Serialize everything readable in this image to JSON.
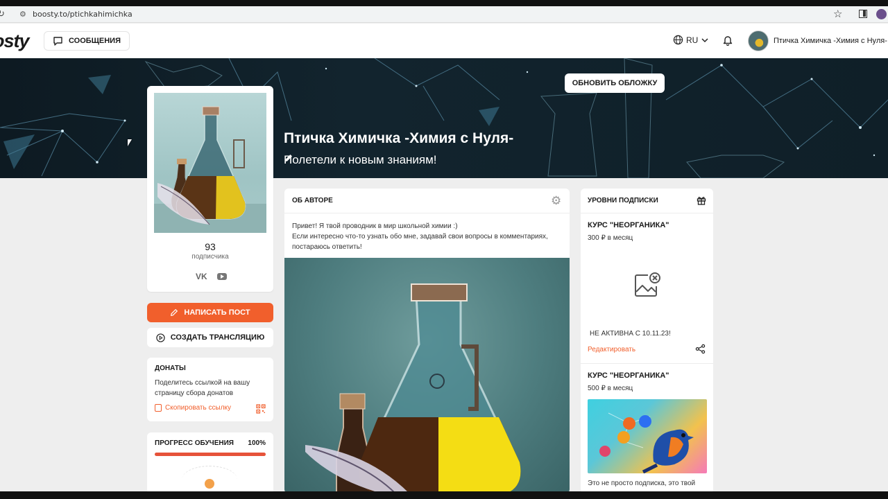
{
  "browser": {
    "url": "boosty.to/ptichkahimichka"
  },
  "header": {
    "logo": "osty",
    "messages_label": "СООБЩЕНИЯ",
    "lang_label": "RU",
    "user_name": "Птичка Химичка -Химия с Нуля-"
  },
  "cover": {
    "update_cover_label": "ОБНОВИТЬ ОБЛОЖКУ",
    "title": "Птичка Химичка -Химия с Нуля-",
    "subtitle": "Полетели к новым знаниям!"
  },
  "profile": {
    "subscribers_count": "93",
    "subscribers_label": "подписчика"
  },
  "actions": {
    "write_post_label": "НАПИСАТЬ ПОСТ",
    "create_stream_label": "СОЗДАТЬ ТРАНСЛЯЦИЮ"
  },
  "donations": {
    "title": "ДОНАТЫ",
    "text": "Поделитесь ссылкой на вашу страницу сбора донатов",
    "copy_link_label": "Скопировать ссылку"
  },
  "progress": {
    "title": "ПРОГРЕСС ОБУЧЕНИЯ",
    "percent_label": "100%",
    "value": 1.0
  },
  "about": {
    "title": "ОБ АВТОРЕ",
    "line1": "Привет! Я твой проводник в мир школьной химии :)",
    "line2": "Если интересно что-то узнать обо мне, задавай свои вопросы в комментариях, постараюсь ответить!"
  },
  "levels": {
    "title": "УРОВНИ ПОДПИСКИ",
    "tiers": [
      {
        "name": "КУРС \"НЕОРГАНИКА\"",
        "price": "300 ₽ в месяц",
        "status": "НЕ АКТИВНА С 10.11.23!",
        "edit_label": "Редактировать"
      },
      {
        "name": "КУРС \"НЕОРГАНИКА\"",
        "price": "500 ₽ в месяц",
        "description": "Это не просто подписка, это твой"
      }
    ]
  },
  "colors": {
    "accent": "#f15f2c",
    "background": "#eeeeee"
  }
}
